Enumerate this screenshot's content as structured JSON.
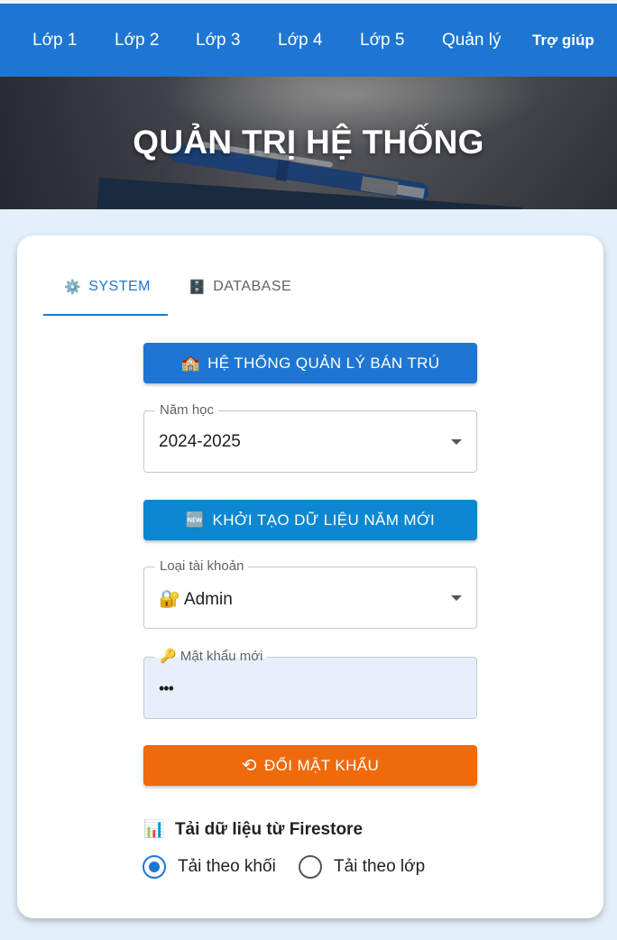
{
  "nav": {
    "items": [
      "Lớp 1",
      "Lớp 2",
      "Lớp 3",
      "Lớp 4",
      "Lớp 5",
      "Quản lý",
      "Trợ giúp"
    ]
  },
  "hero": {
    "title": "QUẢN TRỊ HỆ THỐNG"
  },
  "tabs": [
    {
      "label": "SYSTEM",
      "icon": "⚙️",
      "icon_name": "gear-icon",
      "active": true
    },
    {
      "label": "DATABASE",
      "icon": "🗄️",
      "icon_name": "database-icon",
      "active": false
    }
  ],
  "system": {
    "bantru_button": {
      "label": "HỆ THỐNG QUẢN LÝ BÁN TRÚ",
      "icon": "🏫",
      "icon_name": "school-icon"
    },
    "school_year": {
      "label": "Năm học",
      "value": "2024-2025"
    },
    "init_button": {
      "label": "KHỞI TẠO DỮ LIỆU NĂM MỚI",
      "icon": "🆕",
      "icon_name": "new-icon"
    },
    "account_type": {
      "label": "Loại tài khoản",
      "value": "Admin",
      "icon": "🔐",
      "icon_name": "lock-icon"
    },
    "new_password": {
      "label": "Mật khẩu mới",
      "icon": "🔑",
      "icon_name": "key-icon",
      "value": "•••"
    },
    "change_password_button": {
      "label": "ĐỔI MẬT KHẨU",
      "icon": "⟲",
      "icon_name": "lock-reset-icon"
    },
    "firestore": {
      "title": "Tải dữ liệu từ Firestore",
      "icon": "📊",
      "icon_name": "bar-chart-icon",
      "options": [
        {
          "label": "Tải theo khối",
          "selected": true
        },
        {
          "label": "Tải theo lớp",
          "selected": false
        }
      ]
    }
  },
  "colors": {
    "primary": "#1e76d2",
    "light_blue": "#0c87d2",
    "orange": "#ee6a0b",
    "page_bg": "#e3f0fa"
  }
}
